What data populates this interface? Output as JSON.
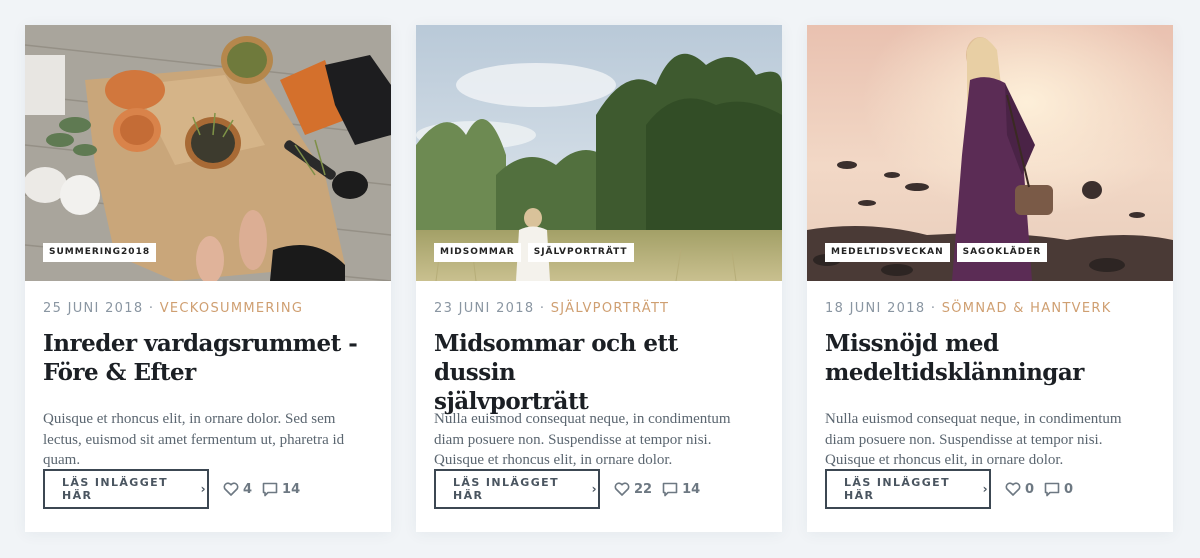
{
  "posts": [
    {
      "tags": [
        "SUMMERING2018"
      ],
      "date": "25 JUNI 2018",
      "separator": " · ",
      "category": "VECKOSUMMERING",
      "title_line1": "Inreder vardagsrummet -",
      "title_line2": "Före & Efter",
      "excerpt": "Quisque et rhoncus elit, in ornare dolor. Sed sem lectus, euismod sit amet fermentum ut, pharetra id quam.",
      "button_label": "LÄS INLÄGGET HÄR",
      "likes": "4",
      "comments": "14",
      "image_subject": "gardening-pots-photo"
    },
    {
      "tags": [
        "MIDSOMMAR",
        "SJÄLVPORTRÄTT"
      ],
      "date": "23 JUNI 2018",
      "separator": " · ",
      "category": "SJÄLVPORTRÄTT",
      "title_line1": "Midsommar och ett dussin",
      "title_line2": "självporträtt",
      "excerpt": "Nulla euismod consequat neque, in condimentum diam posuere non. Suspendisse at tempor nisi. Quisque et rhoncus elit, in ornare dolor.",
      "button_label": "LÄS INLÄGGET HÄR",
      "likes": "22",
      "comments": "14",
      "image_subject": "forest-meadow-photo"
    },
    {
      "tags": [
        "MEDELTIDSVECKAN",
        "SAGOKLÄDER"
      ],
      "date": "18 JUNI 2018",
      "separator": " · ",
      "category": "SÖMNAD & HANTVERK",
      "title_line1": "Missnöjd med",
      "title_line2": "medeltidsklänningar",
      "excerpt": "Nulla euismod consequat neque, in condimentum diam posuere non. Suspendisse at tempor nisi. Quisque et rhoncus elit, in ornare dolor.",
      "button_label": "LÄS INLÄGGET HÄR",
      "likes": "0",
      "comments": "0",
      "image_subject": "sunset-beach-photo"
    }
  ],
  "colors": {
    "accent": "#cf9f71",
    "meta": "#8a96a2",
    "title": "#1b1f24",
    "text": "#5b6670",
    "button_border": "#3c4752"
  },
  "icons": {
    "like": "heart-icon",
    "comment": "comment-icon",
    "arrow": "chevron-right-icon"
  }
}
